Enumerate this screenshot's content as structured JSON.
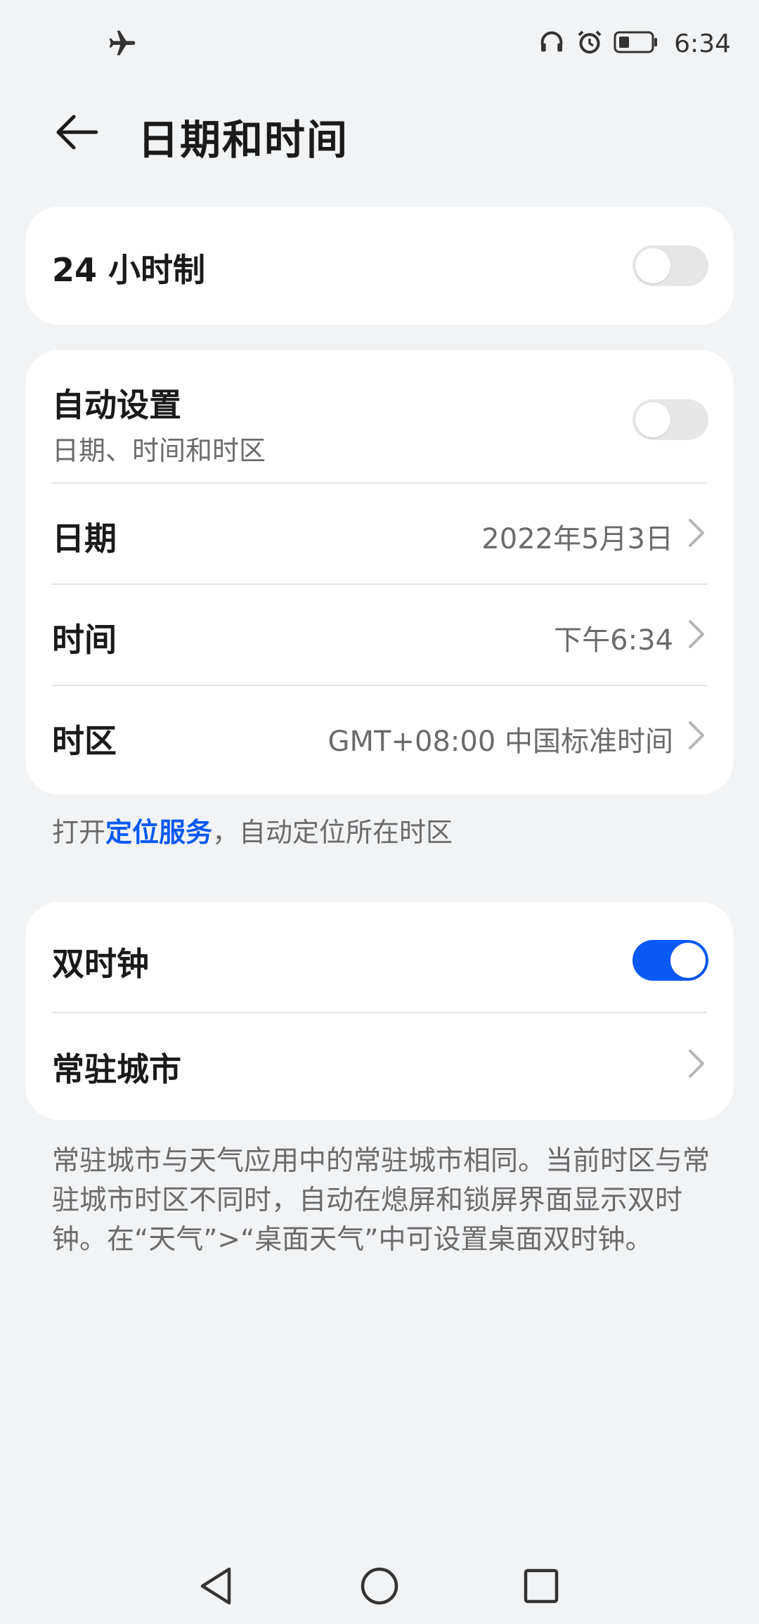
{
  "status_bar": {
    "time": "6:34",
    "icons": [
      "airplane-icon",
      "headphones-icon",
      "alarm-icon",
      "battery-icon"
    ]
  },
  "header": {
    "title": "日期和时间"
  },
  "settings": {
    "hour24": {
      "label": "24 小时制",
      "enabled": false
    },
    "auto": {
      "label": "自动设置",
      "sublabel": "日期、时间和时区",
      "enabled": false
    },
    "date": {
      "label": "日期",
      "value": "2022年5月3日"
    },
    "time": {
      "label": "时间",
      "value": "下午6:34"
    },
    "timezone": {
      "label": "时区",
      "value": "GMT+08:00 中国标准时间"
    },
    "location_note": {
      "prefix": "打开",
      "link": "定位服务",
      "suffix": "，自动定位所在时区"
    },
    "dual_clock": {
      "label": "双时钟",
      "enabled": true
    },
    "home_city": {
      "label": "常驻城市"
    },
    "description": "常驻城市与天气应用中的常驻城市相同。当前时区与常驻城市时区不同时，自动在熄屏和锁屏界面显示双时钟。在“天气”>“桌面天气”中可设置桌面双时钟。"
  },
  "colors": {
    "accent": "#0a59f7",
    "background": "#f1f3f5",
    "card": "#ffffff"
  }
}
